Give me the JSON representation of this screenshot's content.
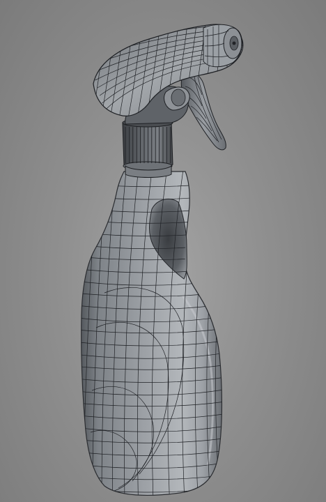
{
  "scene": {
    "subject": "spray-bottle-wireframe-render",
    "colors": {
      "background": "#8f8f8f",
      "surface_light": "#b4b7bb",
      "surface_mid": "#8d9196",
      "surface_dark": "#5d6166",
      "wire": "#1e2024"
    }
  }
}
